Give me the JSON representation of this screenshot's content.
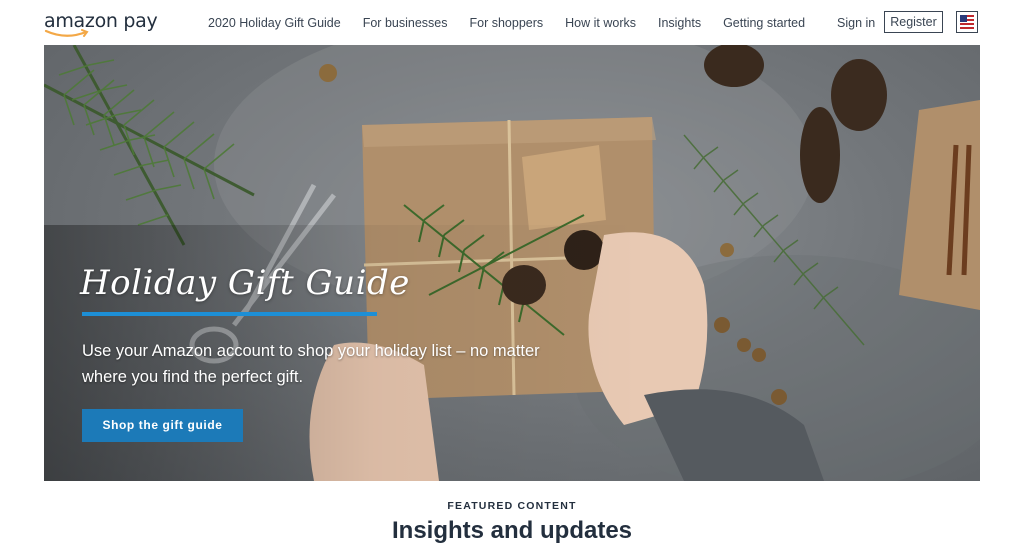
{
  "header": {
    "logo_text": "amazon pay",
    "nav": [
      "2020 Holiday Gift Guide",
      "For businesses",
      "For shoppers",
      "How it works",
      "Insights",
      "Getting started"
    ],
    "signin_label": "Sign in",
    "register_label": "Register",
    "flag_icon": "us-flag-icon"
  },
  "hero": {
    "title": "Holiday Gift Guide",
    "subtitle": "Use your Amazon account to shop your holiday list – no matter where you find the perfect gift.",
    "cta_label": "Shop the gift guide",
    "accent_color": "#1d8fd6",
    "cta_color": "#1c7ab8"
  },
  "featured": {
    "eyebrow": "FEATURED CONTENT",
    "title": "Insights and updates"
  }
}
